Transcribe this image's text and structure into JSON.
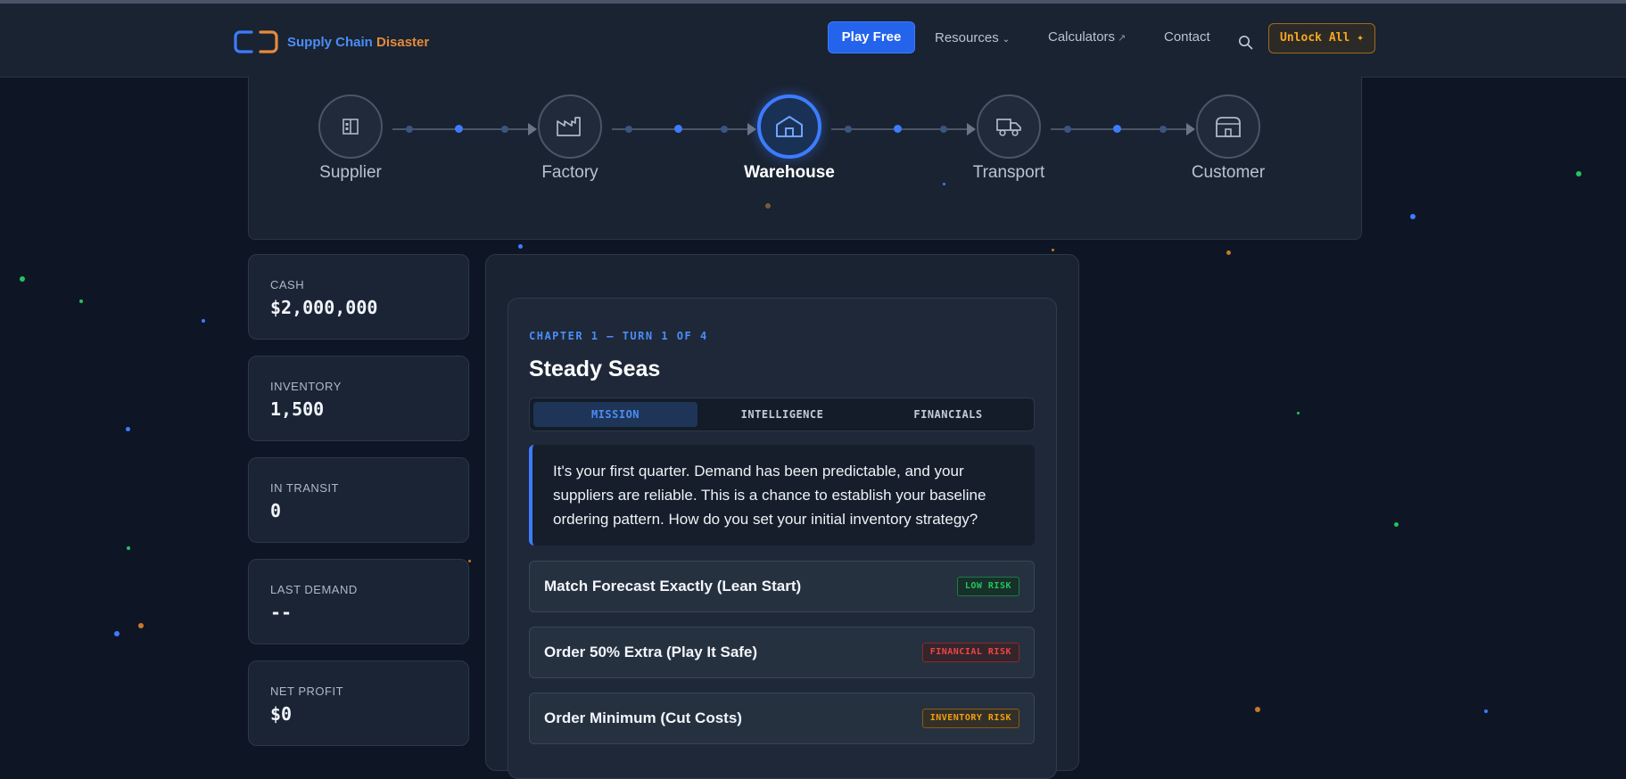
{
  "nav": {
    "brand_part1": "Supply Chain",
    "brand_part2": "Disaster",
    "play_label": "Play Free",
    "resources_label": "Resources",
    "calculators_label": "Calculators",
    "contact_label": "Contact",
    "unlock_label": "Unlock All ✦"
  },
  "stages": [
    {
      "label": "Supplier",
      "icon": "building-icon"
    },
    {
      "label": "Factory",
      "icon": "factory-icon"
    },
    {
      "label": "Warehouse",
      "icon": "warehouse-icon",
      "active": true
    },
    {
      "label": "Transport",
      "icon": "truck-icon"
    },
    {
      "label": "Customer",
      "icon": "store-icon"
    }
  ],
  "stats": [
    {
      "label": "CASH",
      "value": "$2,000,000"
    },
    {
      "label": "INVENTORY",
      "value": "1,500"
    },
    {
      "label": "IN TRANSIT",
      "value": "0"
    },
    {
      "label": "LAST DEMAND",
      "value": "--"
    },
    {
      "label": "NET PROFIT",
      "value": "$0"
    }
  ],
  "game": {
    "chapter": "CHAPTER 1 — TURN 1 OF 4",
    "title": "Steady Seas",
    "tabs": [
      "MISSION",
      "INTELLIGENCE",
      "FINANCIALS"
    ],
    "active_tab": "MISSION",
    "mission_text": "It's your first quarter. Demand has been predictable, and your suppliers are reliable. This is a chance to establish your baseline ordering pattern. How do you set your initial inventory strategy?",
    "options": [
      {
        "label": "Match Forecast Exactly (Lean Start)",
        "risk": "LOW RISK",
        "risk_color": "#22c55e"
      },
      {
        "label": "Order 50% Extra (Play It Safe)",
        "risk": "FINANCIAL RISK",
        "risk_color": "#ef4444"
      },
      {
        "label": "Order Minimum (Cut Costs)",
        "risk": "INVENTORY RISK",
        "risk_color": "#f59e0b"
      }
    ]
  },
  "colors": {
    "accent": "#3d7cff",
    "brand_orange": "#e58a3c",
    "background": "#0e1626"
  }
}
